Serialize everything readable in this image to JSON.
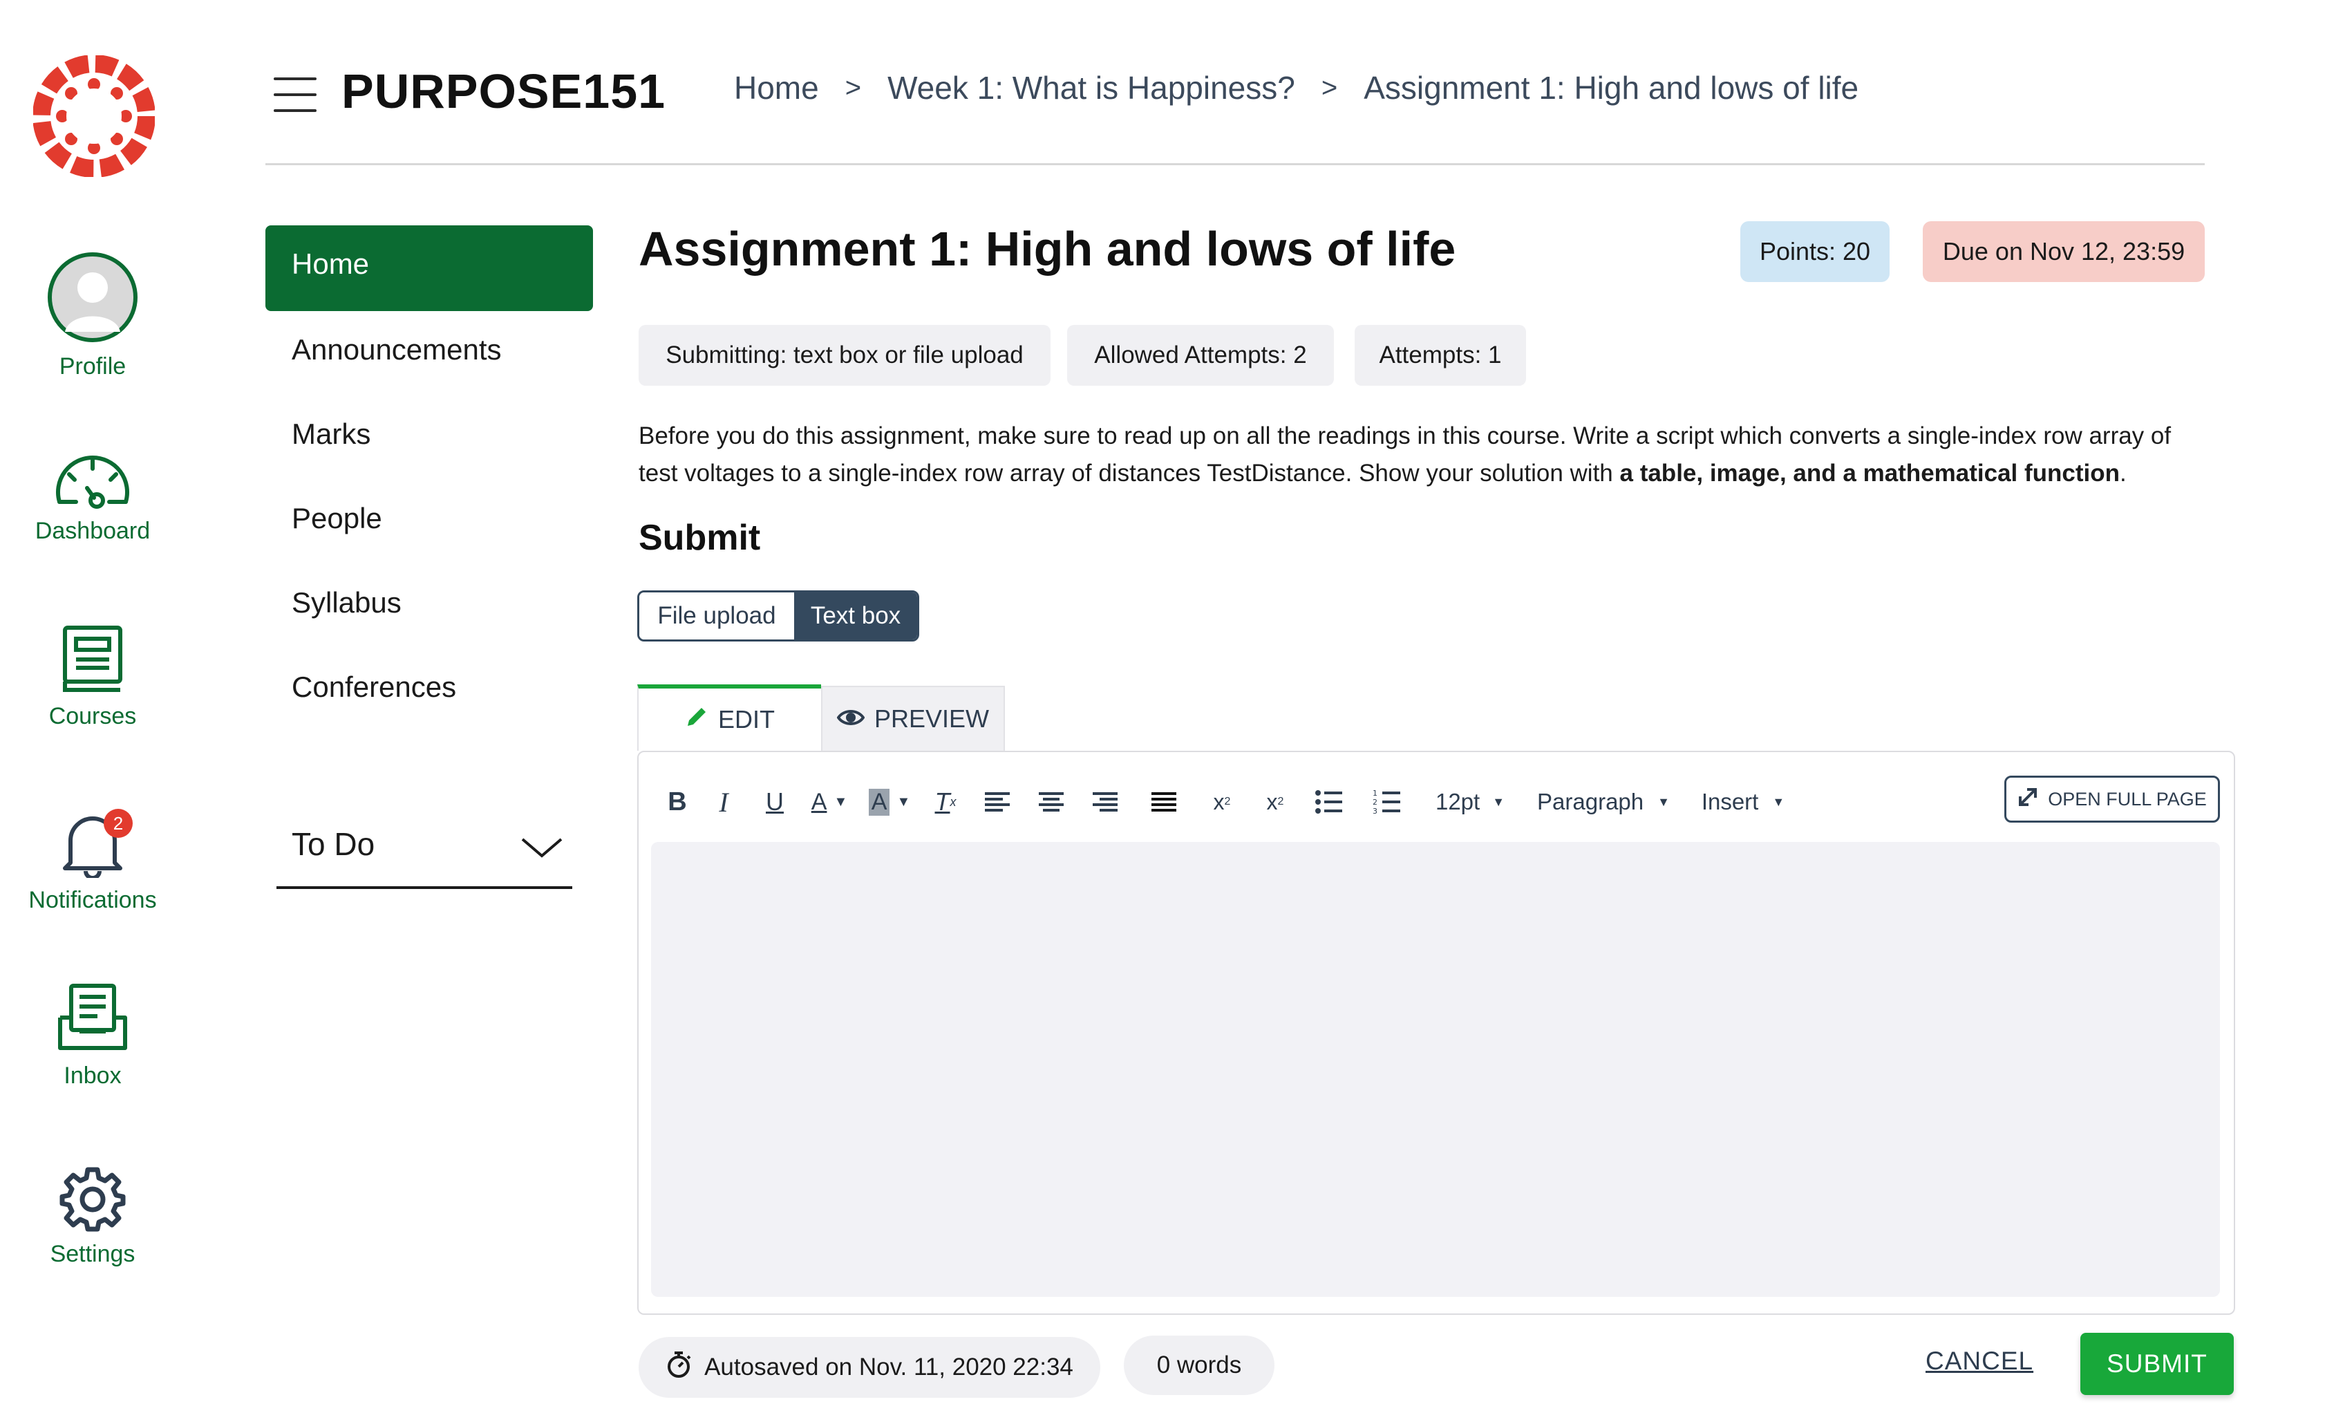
{
  "global_nav": {
    "logo_icon": "canvas-logo-icon",
    "items": [
      {
        "label": "Profile",
        "icon": "avatar-icon"
      },
      {
        "label": "Dashboard",
        "icon": "dashboard-gauge-icon"
      },
      {
        "label": "Courses",
        "icon": "book-icon"
      },
      {
        "label": "Notifications",
        "icon": "bell-icon",
        "badge": "2"
      },
      {
        "label": "Inbox",
        "icon": "inbox-icon"
      },
      {
        "label": "Settings",
        "icon": "gear-icon"
      }
    ]
  },
  "header": {
    "course_title": "PURPOSE151",
    "breadcrumb": [
      "Home",
      ">",
      "Week 1: What is Happiness?",
      ">",
      "Assignment 1: High and lows of life"
    ]
  },
  "course_nav": {
    "items": [
      "Home",
      "Announcements",
      "Marks",
      "People",
      "Syllabus",
      "Conferences"
    ],
    "active": "Home",
    "todo_label": "To Do"
  },
  "assignment": {
    "title": "Assignment 1: High and lows of life",
    "points": "Points: 20",
    "due": "Due on Nov 12, 23:59",
    "meta": [
      "Submitting: text box or file upload",
      "Allowed Attempts: 2",
      "Attempts: 1"
    ],
    "description_plain": "Before you do this assignment, make sure to read up on all the readings in this course. Write a script which converts a single-index row array of test voltages to a single-index row array of distances TestDistance. Show your solution with ",
    "description_bold": "a table, image, and a mathematical function",
    "description_end": "."
  },
  "submit": {
    "heading": "Submit",
    "toggle": [
      "File upload",
      "Text box"
    ],
    "selected": "Text box",
    "tabs": {
      "edit": "EDIT",
      "preview": "PREVIEW"
    },
    "toolbar": {
      "font_size": "12pt",
      "block_format": "Paragraph",
      "insert": "Insert",
      "open_full": "OPEN FULL PAGE"
    },
    "autosave": "Autosaved on Nov. 11, 2020 22:34",
    "word_count": "0 words",
    "cancel": "CANCEL",
    "submit": "SUBMIT"
  },
  "colors": {
    "brand_green": "#0b6b32",
    "submit_green": "#18a83a",
    "canvas_red": "#e23b2e",
    "points_bg": "#cfe6f5",
    "due_bg": "#f7cdc8"
  }
}
